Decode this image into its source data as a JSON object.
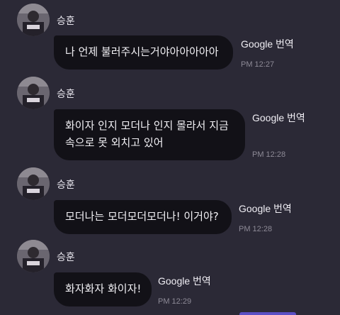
{
  "messages": [
    {
      "sender": "승훈",
      "text": "나 언제 불러주시는거야아아아아아",
      "translate_label": "Google 번역",
      "time": "PM 12:27"
    },
    {
      "sender": "승훈",
      "text": "화이자 인지 모더나 인지 몰라서 지금\n속으로 못 외치고 있어",
      "translate_label": "Google 번역",
      "time": "PM 12:28"
    },
    {
      "sender": "승훈",
      "text": "모더나는 모더모더모더나! 이거야?",
      "translate_label": "Google 번역",
      "time": "PM 12:28"
    },
    {
      "sender": "승훈",
      "text": "화자화자 화이자!",
      "translate_label": "Google 번역",
      "time": "PM 12:29"
    }
  ],
  "colors": {
    "background": "#2b2936",
    "bubble": "#121117",
    "text": "#f2f1f5",
    "time": "#8d8a96"
  }
}
